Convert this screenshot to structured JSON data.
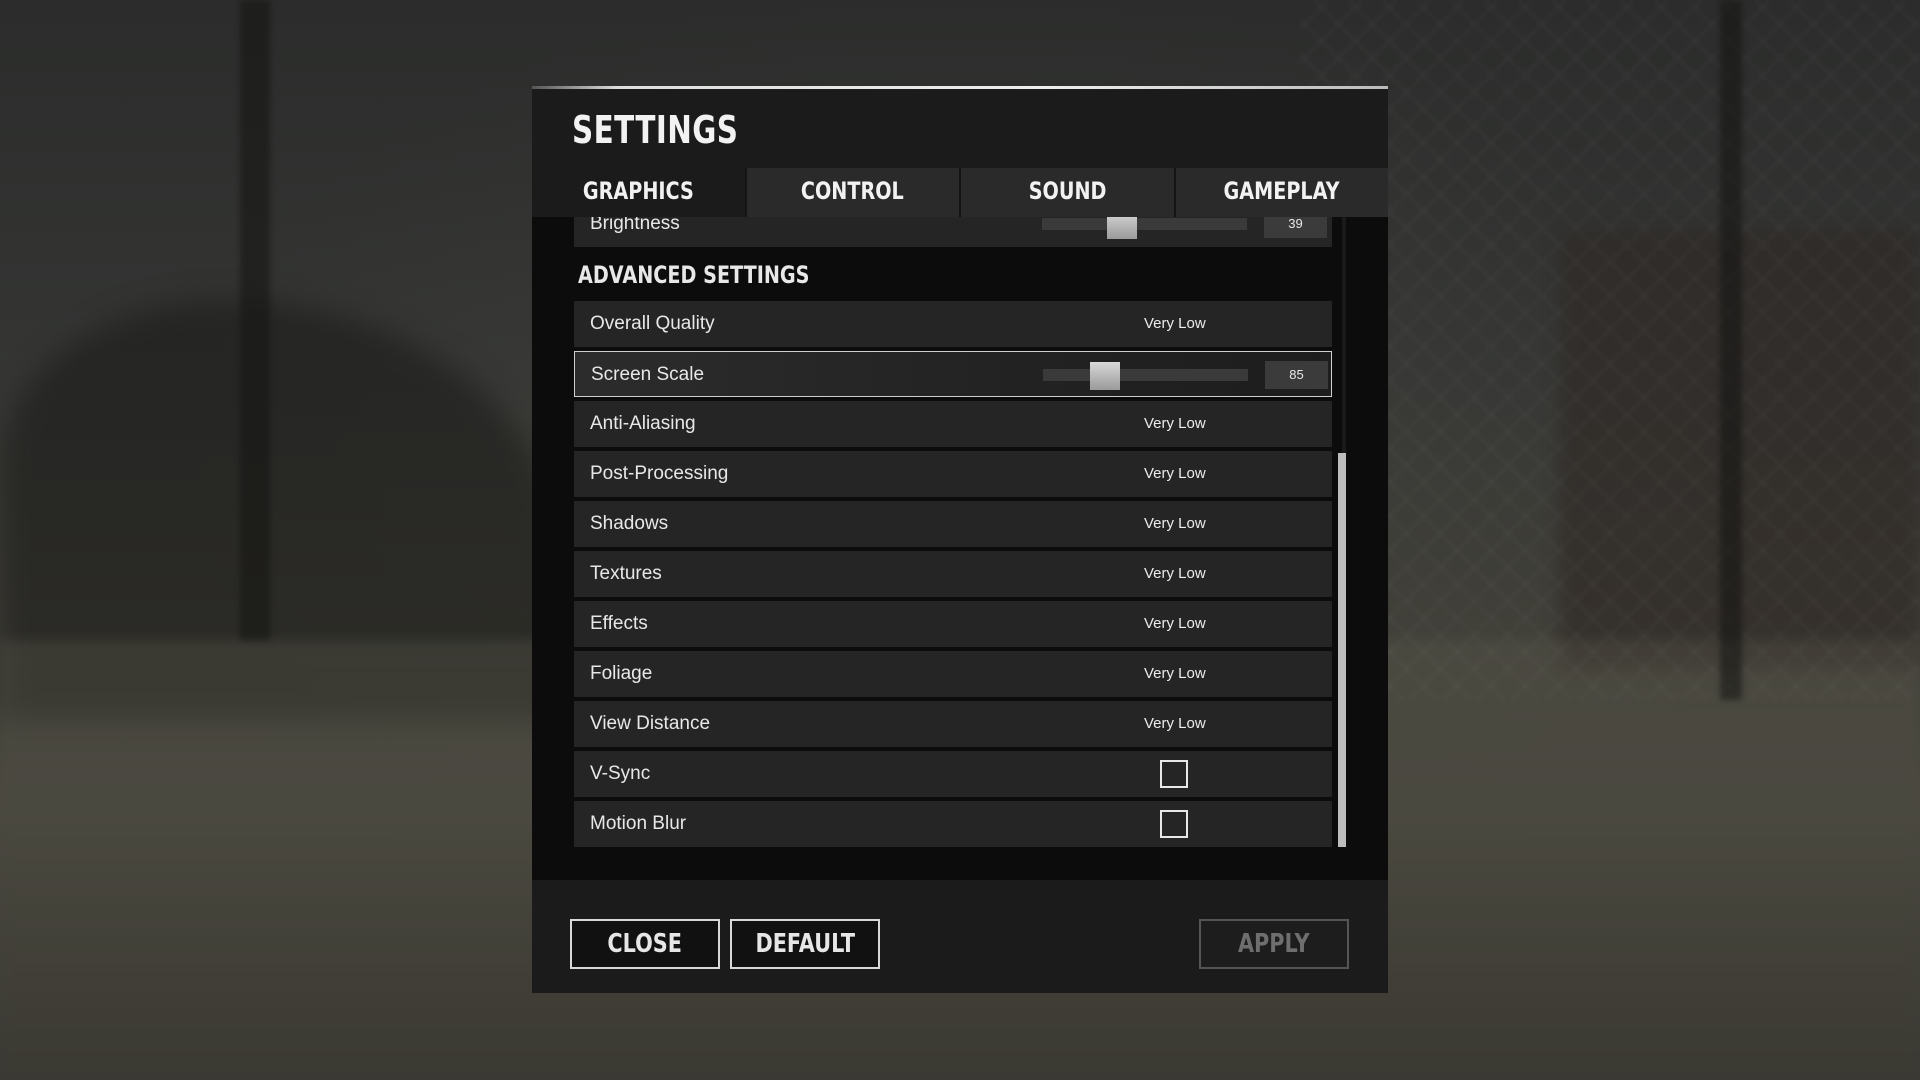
{
  "dialog": {
    "title": "SETTINGS"
  },
  "tabs": [
    {
      "label": "GRAPHICS",
      "active": true
    },
    {
      "label": "CONTROL",
      "active": false
    },
    {
      "label": "SOUND",
      "active": false
    },
    {
      "label": "GAMEPLAY",
      "active": false
    }
  ],
  "brightness": {
    "label": "Brightness",
    "value": "39",
    "level": 0.39
  },
  "advanced": {
    "title": "ADVANCED SETTINGS",
    "overall_quality": {
      "label": "Overall Quality",
      "value": "Very Low"
    },
    "screen_scale": {
      "label": "Screen Scale",
      "value": "85",
      "level": 0.3
    },
    "anti_aliasing": {
      "label": "Anti-Aliasing",
      "value": "Very Low"
    },
    "post_processing": {
      "label": "Post-Processing",
      "value": "Very Low"
    },
    "shadows": {
      "label": "Shadows",
      "value": "Very Low"
    },
    "textures": {
      "label": "Textures",
      "value": "Very Low"
    },
    "effects": {
      "label": "Effects",
      "value": "Very Low"
    },
    "foliage": {
      "label": "Foliage",
      "value": "Very Low"
    },
    "view_distance": {
      "label": "View Distance",
      "value": "Very Low"
    },
    "vsync": {
      "label": "V-Sync",
      "checked": false
    },
    "motion_blur": {
      "label": "Motion Blur",
      "checked": false
    }
  },
  "footer": {
    "close_label": "CLOSE",
    "default_label": "DEFAULT",
    "apply_label": "APPLY"
  }
}
